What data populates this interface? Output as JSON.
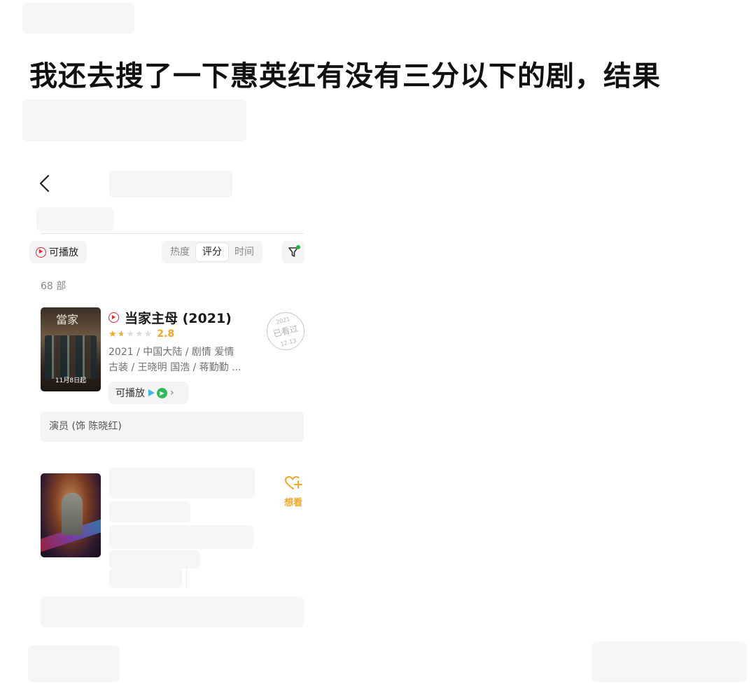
{
  "headline": "我还去搜了一下惠英红有没有三分以下的剧，结果",
  "filters": {
    "playable_label": "可播放",
    "sort_tabs": [
      {
        "label": "热度",
        "active": false
      },
      {
        "label": "评分",
        "active": true
      },
      {
        "label": "时间",
        "active": false
      }
    ],
    "filter_icon": "funnel-icon",
    "filter_active_dot_color": "#2ab04b"
  },
  "result_count": "68 部",
  "items": [
    {
      "title": "当家主母 (2021)",
      "rating_stars": 1.5,
      "rating_score": "2.8",
      "meta_line1": "2021 / 中国大陆 / 剧情 爱情",
      "meta_line2": "古装 / 王晓明 国浩 / 蒋勤勤 ...",
      "poster_date_text": "11月8日起",
      "watched_stamp": {
        "year": "2021",
        "label": "已看过",
        "date": "12.13"
      },
      "playable_chip_label": "可播放",
      "role": "演员 (饰 陈晓红)"
    },
    {
      "wish_label": "想看"
    }
  ],
  "colors": {
    "accent_red": "#e0262e",
    "rating_orange": "#f5a623",
    "chip_bg": "#f4f4f4"
  }
}
